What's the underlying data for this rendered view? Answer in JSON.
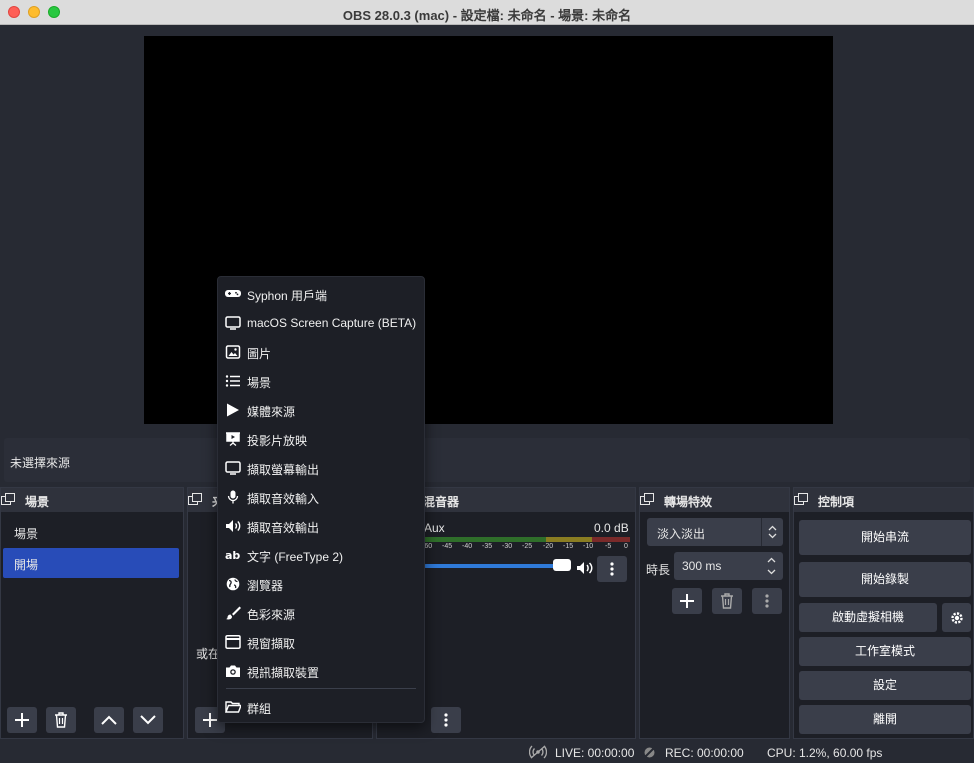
{
  "window": {
    "title": "OBS 28.0.3 (mac) - 設定檔: 未命名 - 場景: 未命名"
  },
  "source_bar": {
    "label": "未選擇來源"
  },
  "scenes": {
    "title": "場景",
    "items": [
      {
        "label": "場景",
        "active": false
      },
      {
        "label": "開場",
        "active": true
      }
    ]
  },
  "sources": {
    "title_partial": "来",
    "hint_partial": "或在"
  },
  "mixer": {
    "title": "混音器",
    "track": {
      "name": "Aux",
      "level": "0.0 dB"
    },
    "ticks": [
      "-60",
      "-45",
      "-40",
      "-35",
      "-30",
      "-25",
      "-20",
      "-15",
      "-10",
      "-5",
      "0"
    ],
    "volume": 1.0
  },
  "transitions": {
    "title": "轉場特效",
    "selected": "淡入淡出",
    "duration_label": "時長",
    "duration_value": "300 ms"
  },
  "controls": {
    "title": "控制項",
    "start_streaming": "開始串流",
    "start_recording": "開始錄製",
    "start_virtual_camera": "啟動虛擬相機",
    "studio_mode": "工作室模式",
    "settings": "設定",
    "exit": "離開"
  },
  "status": {
    "live": "LIVE: 00:00:00",
    "rec": "REC: 00:00:00",
    "cpu": "CPU: 1.2%, 60.00 fps"
  },
  "menu": {
    "items": [
      {
        "label": "Syphon 用戶端",
        "icon": "gamepad-icon"
      },
      {
        "label": "macOS Screen Capture (BETA)",
        "icon": "monitor-icon"
      },
      {
        "label": "圖片",
        "icon": "image-icon"
      },
      {
        "label": "場景",
        "icon": "list-icon"
      },
      {
        "label": "媒體來源",
        "icon": "play-icon"
      },
      {
        "label": "投影片放映",
        "icon": "slideshow-icon"
      },
      {
        "label": "擷取螢幕輸出",
        "icon": "monitor-icon"
      },
      {
        "label": "擷取音效輸入",
        "icon": "microphone-icon"
      },
      {
        "label": "擷取音效輸出",
        "icon": "speaker-icon"
      },
      {
        "label": "文字 (FreeType 2)",
        "icon": "text-icon"
      },
      {
        "label": "瀏覽器",
        "icon": "globe-icon"
      },
      {
        "label": "色彩來源",
        "icon": "brush-icon"
      },
      {
        "label": "視窗擷取",
        "icon": "window-icon"
      },
      {
        "label": "視訊擷取裝置",
        "icon": "camera-icon"
      },
      {
        "label": "群組",
        "icon": "folder-icon"
      }
    ]
  }
}
